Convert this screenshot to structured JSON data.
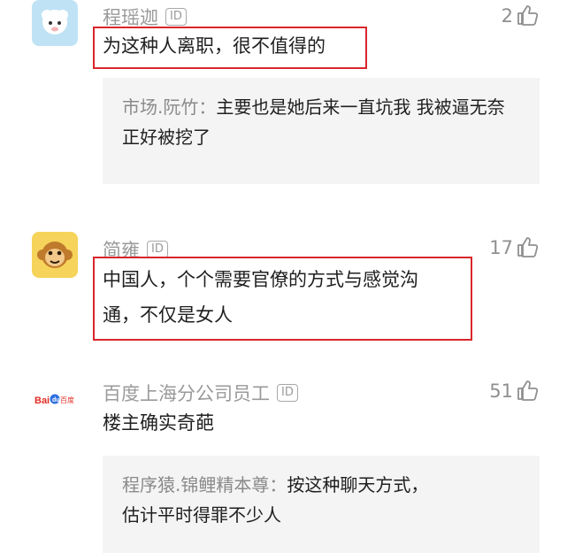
{
  "comments": [
    {
      "user": "程瑶迦",
      "id_badge": "ID",
      "likes": "2",
      "text": "为这种人离职，很不值得的",
      "avatar_icon": "sheep-avatar-icon",
      "reply": {
        "user": "市场.阮竹：",
        "text": "主要也是她后来一直坑我 我被逼无奈 正好被挖了"
      }
    },
    {
      "user": "简雍",
      "id_badge": "ID",
      "likes": "17",
      "text_line1": "中国人，个个需要官僚的方式与感觉沟",
      "text_line2": "通，不仅是女人",
      "avatar_icon": "monkey-avatar-icon"
    },
    {
      "user": "百度上海分公司员工",
      "id_badge": "ID",
      "likes": "51",
      "text": "楼主确实奇葩",
      "avatar_icon": "baidu-logo-icon",
      "avatar_label": "Bai度百度",
      "reply": {
        "user": "程序猿.锦鲤精本尊：",
        "text_line1": "按这种聊天方式，",
        "text_line2": "估计平时得罪不少人"
      }
    }
  ],
  "colors": {
    "highlight": "#d9262c",
    "reply_bg": "#f4f4f5",
    "muted": "#9a9a9a"
  }
}
